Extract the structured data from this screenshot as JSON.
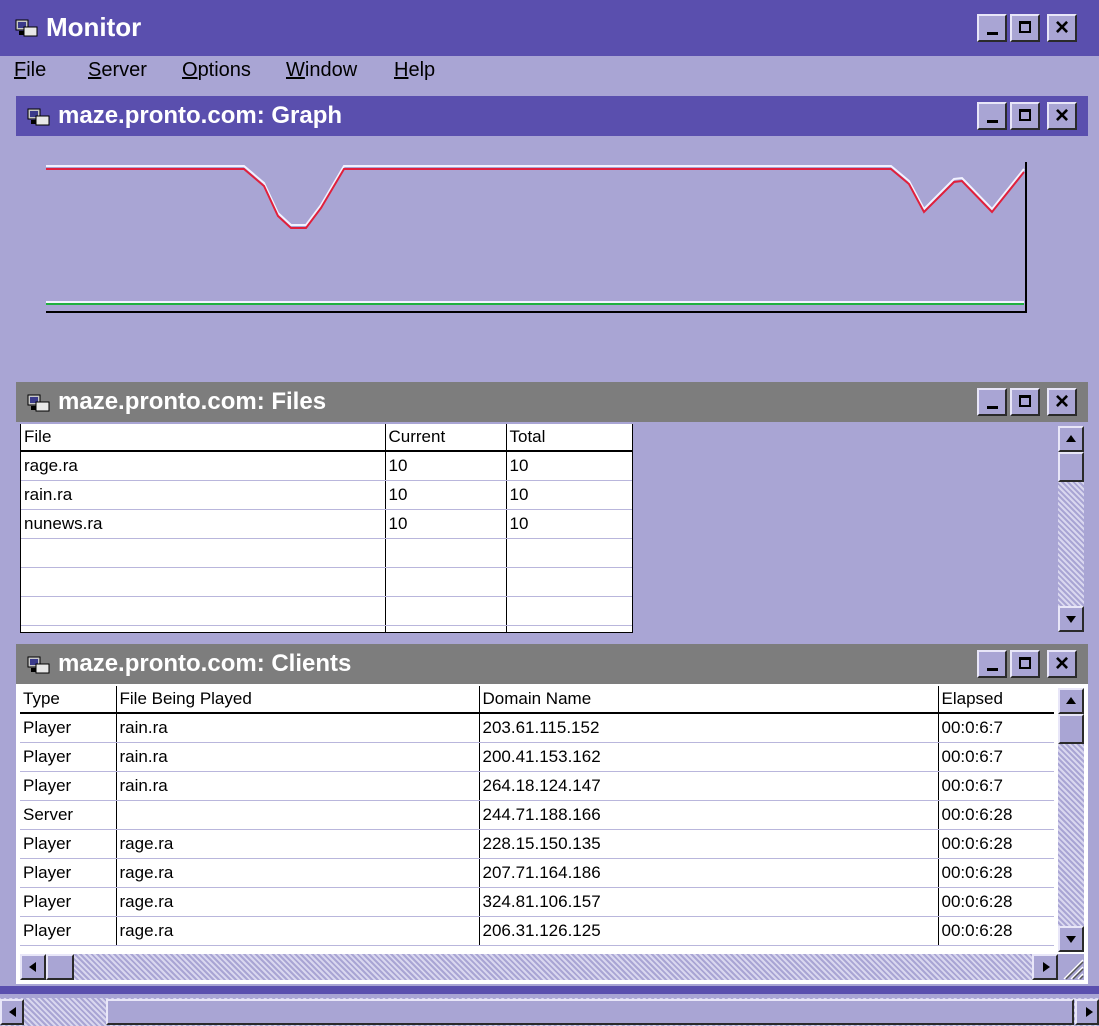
{
  "app": {
    "title": "Monitor"
  },
  "menu": [
    {
      "mnemonic": "F",
      "rest": "ile"
    },
    {
      "mnemonic": "S",
      "rest": "erver"
    },
    {
      "mnemonic": "O",
      "rest": "ptions"
    },
    {
      "mnemonic": "W",
      "rest": "indow"
    },
    {
      "mnemonic": "H",
      "rest": "elp"
    }
  ],
  "graph_window": {
    "title": "maze.pronto.com: Graph"
  },
  "files_window": {
    "title": "maze.pronto.com: Files",
    "columns": [
      "File",
      "Current",
      "Total"
    ],
    "rows": [
      [
        "rage.ra",
        "10",
        "10"
      ],
      [
        "rain.ra",
        "10",
        "10"
      ],
      [
        "nunews.ra",
        "10",
        "10"
      ]
    ]
  },
  "clients_window": {
    "title": "maze.pronto.com: Clients",
    "columns": [
      "Type",
      "File Being Played",
      "Domain Name",
      "Elapsed"
    ],
    "rows": [
      [
        "Player",
        "rain.ra",
        "203.61.115.152",
        "00:0:6:7"
      ],
      [
        "Player",
        "rain.ra",
        "200.41.153.162",
        "00:0:6:7"
      ],
      [
        "Player",
        "rain.ra",
        "264.18.124.147",
        "00:0:6:7"
      ],
      [
        "Server",
        "",
        "244.71.188.166",
        "00:0:6:28"
      ],
      [
        "Player",
        "rage.ra",
        "228.15.150.135",
        "00:0:6:28"
      ],
      [
        "Player",
        "rage.ra",
        "207.71.164.186",
        "00:0:6:28"
      ],
      [
        "Player",
        "rage.ra",
        "324.81.106.157",
        "00:0:6:28"
      ],
      [
        "Player",
        "rage.ra",
        "206.31.126.125",
        "00:0:6:28"
      ]
    ]
  },
  "colors": {
    "active_title": "#5a4fae",
    "inactive_title": "#7d7d7d",
    "background": "#a9a5d4",
    "graph_line_red": "#e0203c",
    "graph_line_green": "#20b040"
  },
  "icons": [
    "app-icon",
    "minimize-icon",
    "maximize-icon",
    "close-icon",
    "scroll-up-icon",
    "scroll-down-icon",
    "scroll-left-icon",
    "scroll-right-icon",
    "size-grip-icon"
  ]
}
